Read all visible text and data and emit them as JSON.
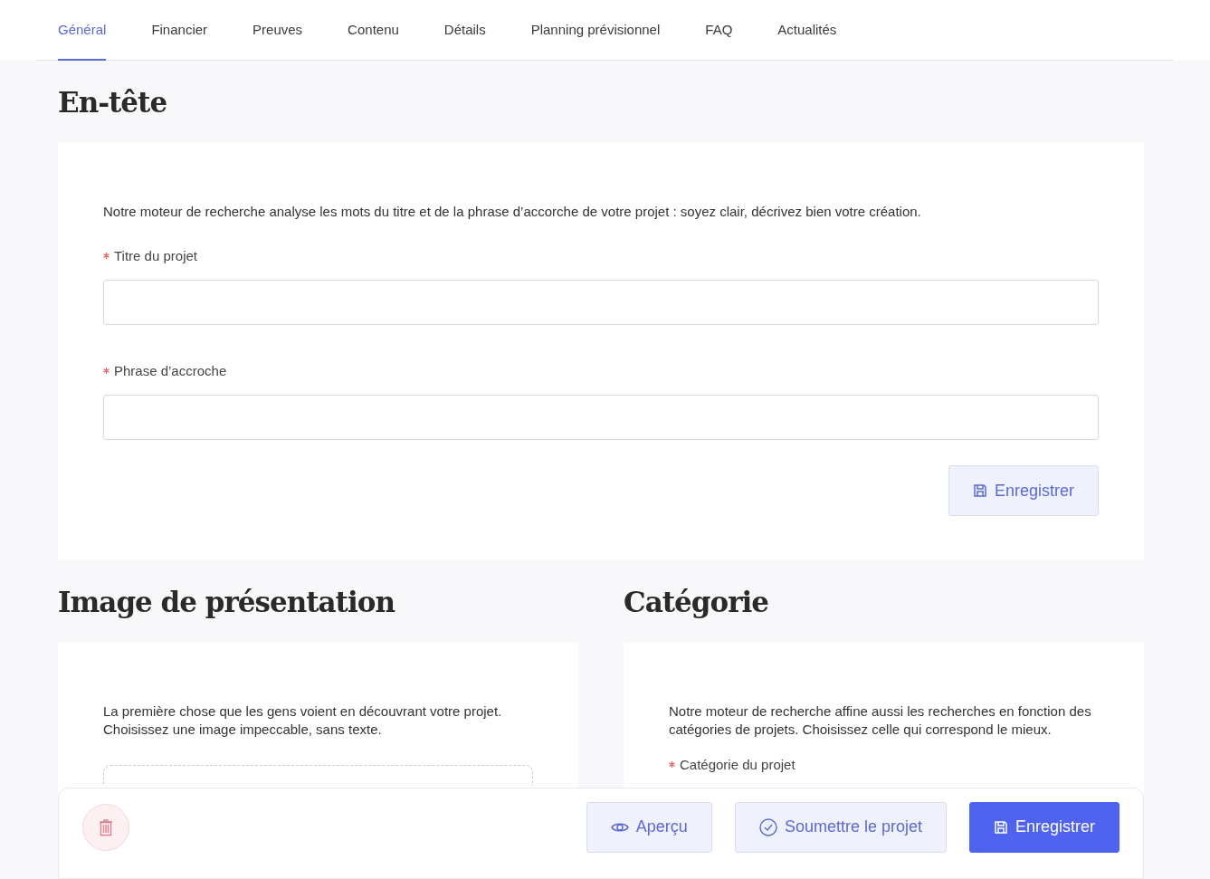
{
  "tabs": [
    {
      "label": "Général",
      "selected": true
    },
    {
      "label": "Financier",
      "selected": false
    },
    {
      "label": "Preuves",
      "selected": false
    },
    {
      "label": "Contenu",
      "selected": false
    },
    {
      "label": "Détails",
      "selected": false
    },
    {
      "label": "Planning prévisionnel",
      "selected": false
    },
    {
      "label": "FAQ",
      "selected": false
    },
    {
      "label": "Actualités",
      "selected": false
    }
  ],
  "header_section": {
    "title": "En-tête",
    "intro": "Notre moteur de recherche analyse les mots du titre et de la phrase d’accorche de votre projet : soyez clair, décrivez bien votre création.",
    "fields": [
      {
        "label": "Titre du projet",
        "required": true
      },
      {
        "label": "Phrase d’accroche",
        "required": true
      }
    ],
    "save_button": {
      "label": "Enregistrer"
    }
  },
  "image_section": {
    "title": "Image de présentation",
    "intro": "La première chose que les gens voient en découvrant votre projet. Choisissez une image impeccable, sans texte."
  },
  "category_section": {
    "title": "Catégorie",
    "intro": "Notre moteur de recherche affine aussi les recherches en fonction des catégories de projets. Choisissez celle qui correspond le mieux.",
    "field": {
      "label": "Catégorie du projet",
      "required": true
    }
  },
  "bottom_bar": {
    "buttons": [
      {
        "label": "Aperçu",
        "kind": "secondary"
      },
      {
        "label": "Soumettre le projet",
        "kind": "secondary"
      },
      {
        "label": "Enregistrer",
        "kind": "primary"
      }
    ]
  }
}
